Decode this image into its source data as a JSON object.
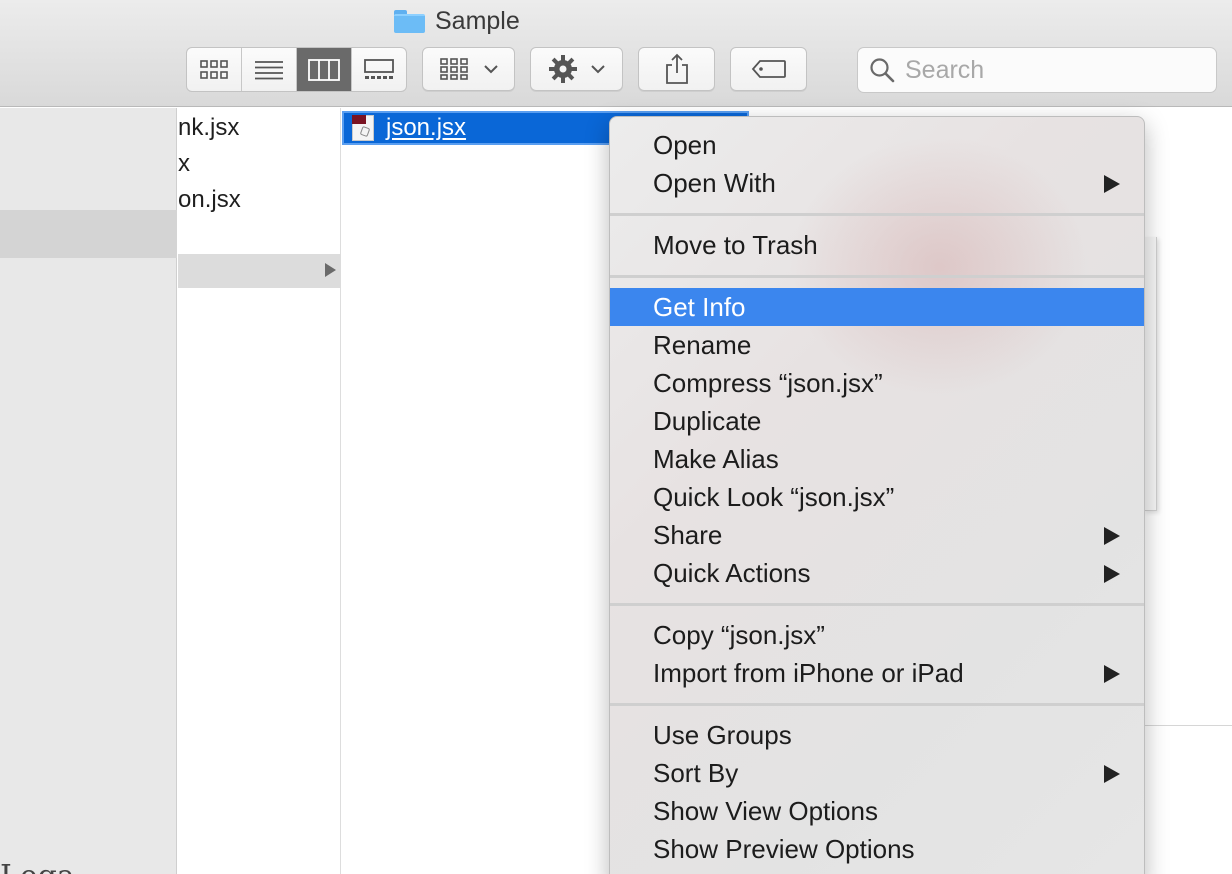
{
  "window": {
    "title": "Sample",
    "search_placeholder": "Search"
  },
  "toolbar": {
    "view_buttons": [
      "icon-view",
      "list-view",
      "column-view",
      "gallery-view"
    ],
    "active_view": "column-view"
  },
  "column1": {
    "items": [
      "nk.jsx",
      "x",
      "on.jsx"
    ]
  },
  "column2": {
    "selected_file": "json.jsx"
  },
  "context_menu": {
    "items": [
      {
        "label": "Open"
      },
      {
        "label": "Open With",
        "submenu": true
      },
      {
        "label": "Move to Trash"
      },
      {
        "label": "Get Info",
        "highlighted": true
      },
      {
        "label": "Rename"
      },
      {
        "label": "Compress “json.jsx”"
      },
      {
        "label": "Duplicate"
      },
      {
        "label": "Make Alias"
      },
      {
        "label": "Quick Look “json.jsx”"
      },
      {
        "label": "Share",
        "submenu": true
      },
      {
        "label": "Quick Actions",
        "submenu": true
      },
      {
        "label": "Copy “json.jsx”"
      },
      {
        "label": "Import from iPhone or iPad",
        "submenu": true
      },
      {
        "label": "Use Groups"
      },
      {
        "label": "Sort By",
        "submenu": true
      },
      {
        "label": "Show View Options"
      },
      {
        "label": "Show Preview Options"
      }
    ]
  },
  "background_text": "Lega",
  "colors": {
    "selection": "#0a67d7",
    "menu_highlight": "#3b86ee",
    "folder": "#6cbcf6"
  }
}
